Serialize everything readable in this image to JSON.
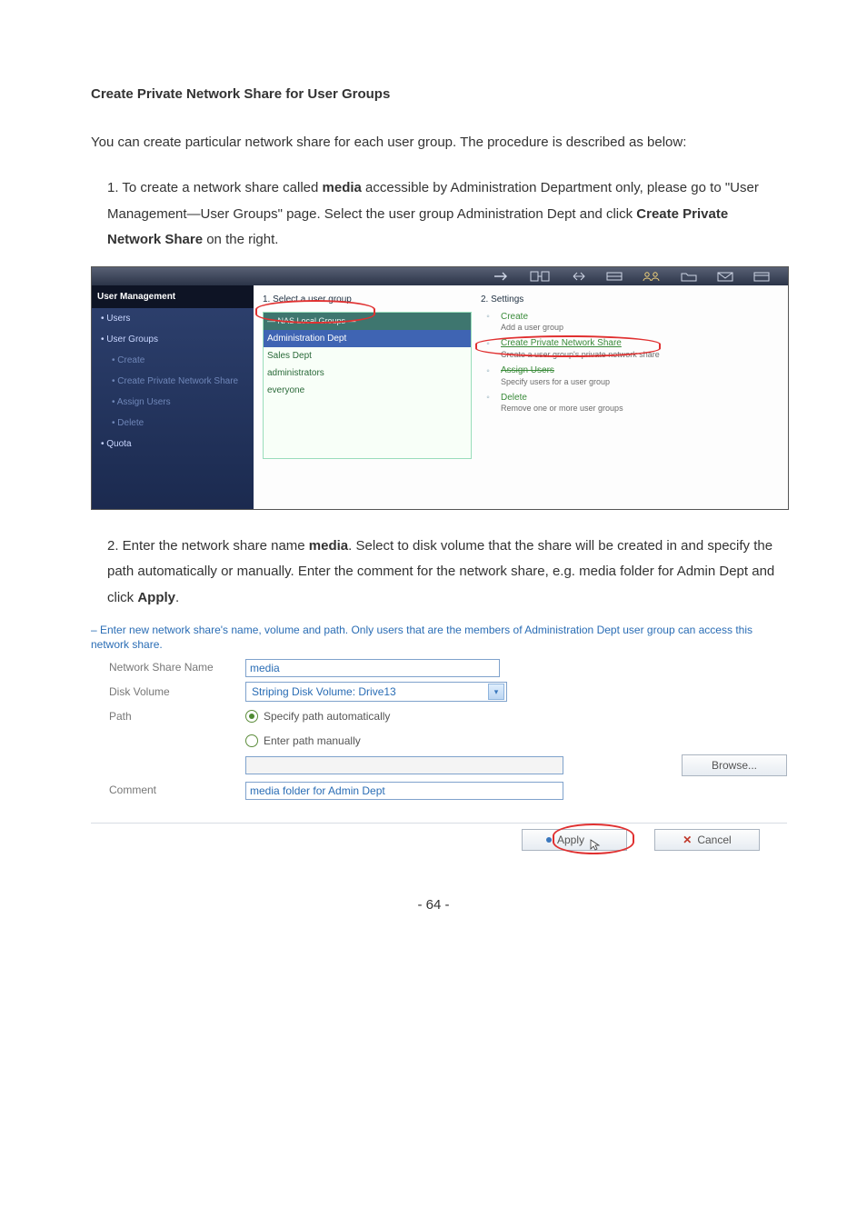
{
  "doc": {
    "heading": "Create Private Network Share for User Groups",
    "intro": "You can create particular network share for each user group.  The procedure is described as below:",
    "step1_lead": "1.  To create a network share called ",
    "step1_bold1": "media",
    "step1_mid": " accessible by Administration Department only, please go to \"User Management—User Groups\" page. Select the user group Administration Dept and click ",
    "step1_bold2": "Create Private Network Share",
    "step1_end": " on the right.",
    "step2_lead": "2.  Enter the network share name ",
    "step2_bold1": "media",
    "step2_mid": ".  Select to disk volume that the share will be created in and specify the path automatically or manually.  Enter the comment for the network share, e.g. media folder for Admin Dept and click ",
    "step2_bold2": "Apply",
    "step2_end": ".",
    "page_num": "- 64 -"
  },
  "shot1": {
    "side_header": "User Management",
    "side": {
      "users": "• Users",
      "groups": "• User Groups",
      "create": "• Create",
      "cpns": "• Create Private Network Share",
      "assign": "• Assign Users",
      "delete": "• Delete",
      "quota": "• Quota"
    },
    "col1_h": "1. Select a user group",
    "list_hdr": "— NAS Local Groups —",
    "rows": [
      "Administration Dept",
      "Sales Dept",
      "administrators",
      "everyone"
    ],
    "col2_h": "2. Settings",
    "settings": [
      {
        "link": "Create",
        "desc": "Add a user group"
      },
      {
        "link": "Create Private Network Share",
        "desc": "Create a user group's private network share",
        "underline": true,
        "circled": true
      },
      {
        "link": "Assign Users",
        "desc": "Specify users for a user group",
        "strike": true
      },
      {
        "link": "Delete",
        "desc": "Remove one or more user groups"
      }
    ]
  },
  "shot2": {
    "note": "– Enter new network share's name, volume and path. Only users that are the members of Administration Dept user group can access this network share.",
    "labels": {
      "name": "Network Share Name",
      "disk": "Disk Volume",
      "path": "Path",
      "comment": "Comment"
    },
    "name_value": "media",
    "disk_value": "Striping Disk Volume: Drive13",
    "path_auto": "Specify path automatically",
    "path_manual": "Enter path manually",
    "comment_value": "media folder for Admin Dept",
    "browse": "Browse...",
    "apply": "Apply",
    "cancel": "Cancel"
  }
}
